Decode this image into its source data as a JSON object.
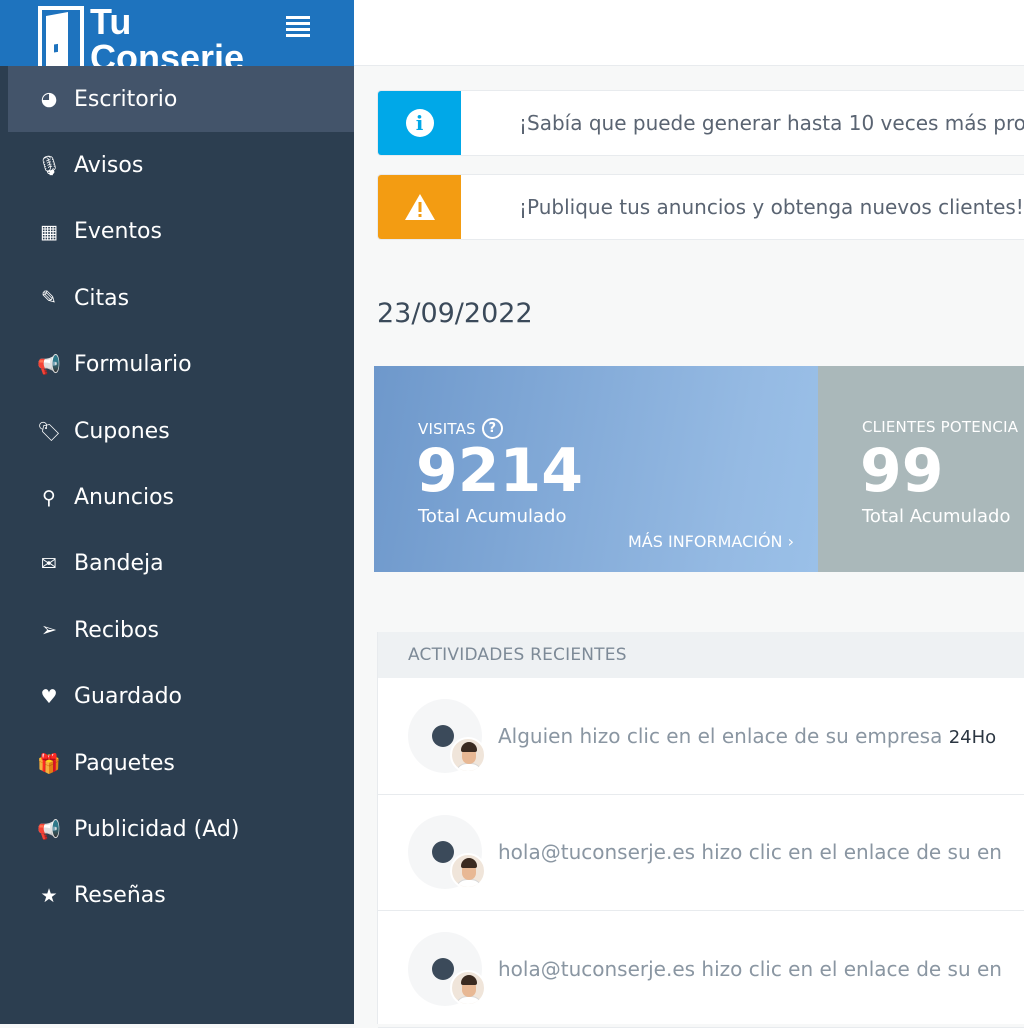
{
  "brand": {
    "line1": "Tu",
    "line2": "Conserje"
  },
  "sidebar": {
    "items": [
      {
        "label": "Escritorio",
        "icon": "dashboard-icon",
        "glyph": "◕",
        "active": true
      },
      {
        "label": "Avisos",
        "icon": "microphone-icon",
        "glyph": "🎙"
      },
      {
        "label": "Eventos",
        "icon": "calendar-icon",
        "glyph": "▦"
      },
      {
        "label": "Citas",
        "icon": "edit-icon",
        "glyph": "✎"
      },
      {
        "label": "Formulario",
        "icon": "bullhorn-icon",
        "glyph": "📢"
      },
      {
        "label": "Cupones",
        "icon": "tags-icon",
        "glyph": "🏷"
      },
      {
        "label": "Anuncios",
        "icon": "map-marker-icon",
        "glyph": "⚲"
      },
      {
        "label": "Bandeja",
        "icon": "envelope-icon",
        "glyph": "✉"
      },
      {
        "label": "Recibos",
        "icon": "paper-plane-icon",
        "glyph": "➢"
      },
      {
        "label": "Guardado",
        "icon": "heart-icon",
        "glyph": "♥"
      },
      {
        "label": "Paquetes",
        "icon": "gift-icon",
        "glyph": "🎁"
      },
      {
        "label": "Publicidad (Ad)",
        "icon": "bullhorn-icon",
        "glyph": "📢"
      },
      {
        "label": "Reseñas",
        "icon": "star-icon",
        "glyph": "★"
      }
    ]
  },
  "alerts": [
    {
      "text": "¡Sabía que puede generar hasta 10 veces más pro",
      "icon": "info-icon",
      "color": "#00a8e8"
    },
    {
      "text": "¡Publique tus anuncios y obtenga nuevos clientes!",
      "icon": "warning-icon",
      "color": "#f39c12"
    }
  ],
  "date": "23/09/2022",
  "stats": {
    "visits": {
      "label": "VISITAS",
      "value": "9214",
      "sub": "Total Acumulado",
      "more": "MÁS INFORMACIÓN  ›"
    },
    "clients": {
      "label": "CLIENTES POTENCIA",
      "value": "99",
      "sub": "Total Acumulado"
    }
  },
  "activities": {
    "header": "ACTIVIDADES RECIENTES",
    "items": [
      {
        "text": "Alguien hizo clic en el enlace de su empresa ",
        "time": "24Ho"
      },
      {
        "text": "hola@tuconserje.es hizo clic en el enlace de su en",
        "time": ""
      },
      {
        "text": "hola@tuconserje.es hizo clic en el enlace de su en",
        "time": ""
      }
    ]
  }
}
